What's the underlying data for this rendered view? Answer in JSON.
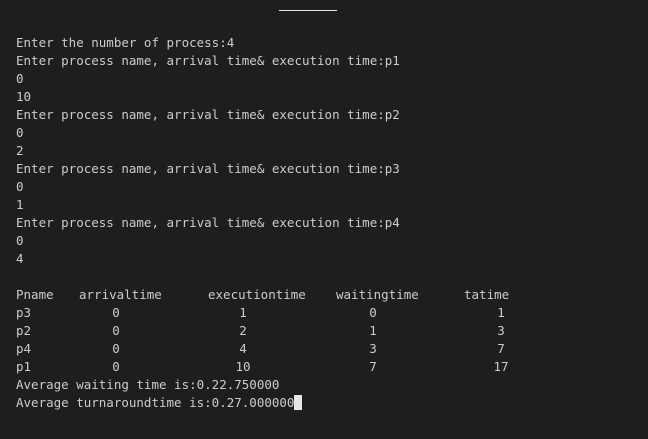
{
  "input_lines": [
    "Enter the number of process:4",
    "Enter process name, arrival time& execution time:p1",
    "0",
    "10",
    "Enter process name, arrival time& execution time:p2",
    "0",
    "2",
    "Enter process name, arrival time& execution time:p3",
    "0",
    "1",
    "Enter process name, arrival time& execution time:p4",
    "0",
    "4"
  ],
  "table": {
    "headers": [
      "Pname",
      "arrivaltime",
      "executiontime",
      "waitingtime",
      "tatime"
    ],
    "rows": [
      [
        "p3",
        "0",
        "1",
        "0",
        "1"
      ],
      [
        "p2",
        "0",
        "2",
        "1",
        "3"
      ],
      [
        "p4",
        "0",
        "4",
        "3",
        "7"
      ],
      [
        "p1",
        "0",
        "10",
        "7",
        "17"
      ]
    ]
  },
  "summary": {
    "avg_waiting": "Average waiting time is:0.22.750000",
    "avg_turnaround": "Average turnaroundtime is:0.27.000000"
  }
}
